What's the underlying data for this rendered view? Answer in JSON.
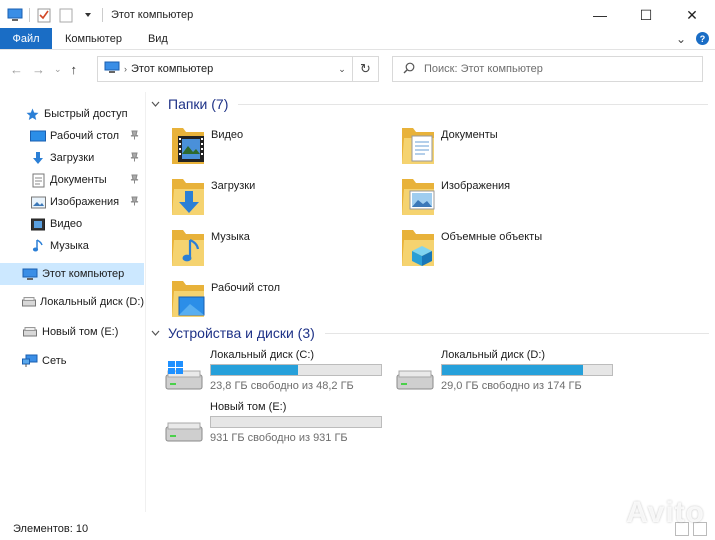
{
  "window": {
    "title": "Этот компьютер",
    "minimize": "—",
    "maximize": "☐",
    "close": "✕"
  },
  "ribbon": {
    "file": "Файл",
    "tabs": [
      "Компьютер",
      "Вид"
    ],
    "expand": "⌄",
    "help": "?"
  },
  "address": {
    "back": "←",
    "forward": "→",
    "recent": "⌄",
    "up": "↑",
    "chevron": "›",
    "path": "Этот компьютер",
    "dropdown": "⌄",
    "refresh": "↻",
    "search_placeholder": "Поиск: Этот компьютер"
  },
  "sidebar": {
    "quick_access": "Быстрый доступ",
    "items": [
      {
        "label": "Рабочий стол",
        "icon": "desktop-icon",
        "pinned": true
      },
      {
        "label": "Загрузки",
        "icon": "download-icon",
        "pinned": true
      },
      {
        "label": "Документы",
        "icon": "document-icon",
        "pinned": true
      },
      {
        "label": "Изображения",
        "icon": "pictures-icon",
        "pinned": true
      },
      {
        "label": "Видео",
        "icon": "video-icon",
        "pinned": false
      },
      {
        "label": "Музыка",
        "icon": "music-icon",
        "pinned": false
      }
    ],
    "this_pc": "Этот компьютер",
    "drive_d": "Локальный диск (D:)",
    "drive_e": "Новый том (E:)",
    "network": "Сеть",
    "pin_glyph": "📌"
  },
  "folders_group": {
    "title": "Папки (7)",
    "items": [
      {
        "label": "Видео",
        "icon": "video-folder-icon"
      },
      {
        "label": "Документы",
        "icon": "documents-folder-icon"
      },
      {
        "label": "Загрузки",
        "icon": "downloads-folder-icon"
      },
      {
        "label": "Изображения",
        "icon": "pictures-folder-icon"
      },
      {
        "label": "Музыка",
        "icon": "music-folder-icon"
      },
      {
        "label": "Объемные объекты",
        "icon": "3d-objects-folder-icon"
      },
      {
        "label": "Рабочий стол",
        "icon": "desktop-folder-icon"
      }
    ]
  },
  "drives_group": {
    "title": "Устройства и диски (3)",
    "items": [
      {
        "name": "Локальный диск (C:)",
        "free": "23,8 ГБ свободно из 48,2 ГБ",
        "used_fraction": 0.51,
        "system": true
      },
      {
        "name": "Локальный диск (D:)",
        "free": "29,0 ГБ свободно из 174 ГБ",
        "used_fraction": 0.83,
        "system": false
      },
      {
        "name": "Новый том (E:)",
        "free": "931 ГБ свободно из 931 ГБ",
        "used_fraction": 0.0,
        "system": false
      }
    ]
  },
  "status": {
    "items_count": "Элементов: 10"
  },
  "watermark": "Avito",
  "colors": {
    "accent": "#1a6dc5",
    "selection": "#cce8ff",
    "drive_bar": "#26a0da",
    "group_title": "#1e3287",
    "folder": "#f3c755"
  }
}
